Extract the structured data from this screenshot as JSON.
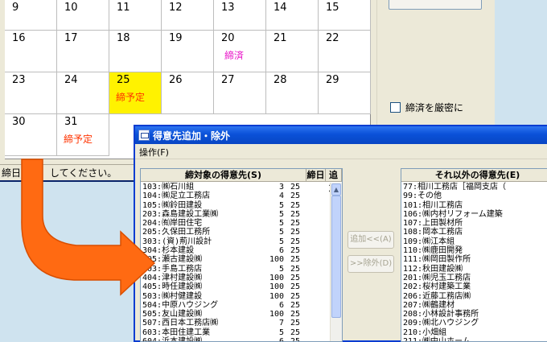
{
  "calendar": {
    "rows": [
      [
        {
          "day": "9"
        },
        {
          "day": "10"
        },
        {
          "day": "11"
        },
        {
          "day": "12"
        },
        {
          "day": "13"
        },
        {
          "day": "14"
        },
        {
          "day": "15"
        }
      ],
      [
        {
          "day": "16"
        },
        {
          "day": "17"
        },
        {
          "day": "18"
        },
        {
          "day": "19"
        },
        {
          "day": "20",
          "status": "締済",
          "status_type": "done"
        },
        {
          "day": "21"
        },
        {
          "day": "22"
        }
      ],
      [
        {
          "day": "23"
        },
        {
          "day": "24"
        },
        {
          "day": "25",
          "status": "締予定",
          "status_type": "due",
          "highlight": true
        },
        {
          "day": "26"
        },
        {
          "day": "27"
        },
        {
          "day": "28"
        },
        {
          "day": "29"
        }
      ],
      [
        {
          "day": "30"
        },
        {
          "day": "31",
          "status": "締予定",
          "status_type": "due"
        }
      ]
    ]
  },
  "side": {
    "checkbox_label": "締済を厳密に"
  },
  "statusbar": {
    "text_left": "締日",
    "text_right": "してください。"
  },
  "dialog": {
    "title": "得意先追加・除外",
    "menu": "操作(F)",
    "left": {
      "header_name": "締対象の得意先(S)",
      "header_day": "締日",
      "header_mode": "追加",
      "rows": [
        {
          "name": "103:㈱石川組",
          "day": "3",
          "mode": "25"
        },
        {
          "name": "104:㈱足立工務店",
          "day": "4",
          "mode": "25"
        },
        {
          "name": "105:㈱鈴田建設",
          "day": "5",
          "mode": "25"
        },
        {
          "name": "203:森島建設工業㈱",
          "day": "5",
          "mode": "25"
        },
        {
          "name": "204:㈲岸田住宅",
          "day": "5",
          "mode": "25"
        },
        {
          "name": "205:久保田工務所",
          "day": "5",
          "mode": "25"
        },
        {
          "name": "303:(資)荊川設計",
          "day": "5",
          "mode": "25"
        },
        {
          "name": "304:杉本建設",
          "day": "6",
          "mode": "25"
        },
        {
          "name": "305:瀬古建設㈱",
          "day": "100",
          "mode": "25"
        },
        {
          "name": "403:手島工務店",
          "day": "5",
          "mode": "25"
        },
        {
          "name": "404:津村建設㈱",
          "day": "100",
          "mode": "25"
        },
        {
          "name": "405:時任建設㈱",
          "day": "100",
          "mode": "25"
        },
        {
          "name": "503:㈱村健建設",
          "day": "100",
          "mode": "25"
        },
        {
          "name": "504:中原ハウジング",
          "day": "6",
          "mode": "25"
        },
        {
          "name": "505:友山建設㈱",
          "day": "100",
          "mode": "25"
        },
        {
          "name": "507:西日本工務店㈱",
          "day": "7",
          "mode": "25"
        },
        {
          "name": "603:本田住建工業",
          "day": "5",
          "mode": "25"
        },
        {
          "name": "604:浜本建設㈱",
          "day": "6",
          "mode": "25"
        }
      ]
    },
    "buttons": {
      "add": "追加<<(A)",
      "remove": ">>除外(D)"
    },
    "right": {
      "header_name": "それ以外の得意先(E)",
      "rows": [
        "77:相川工務店［福岡支店（",
        "99:その他",
        "101:相川工務店",
        "106:㈱内村リフォーム建築",
        "107:上田製材所",
        "108:岡本工務店",
        "109:㈱江本組",
        "110:㈱鹿田開発",
        "111:㈱岡田製作所",
        "112:秋田建設㈱",
        "201:㈱児玉工務店",
        "202:桜村建築工業",
        "206:近藤工務店㈱",
        "207:㈱鶴建材",
        "208:小林設計事務所",
        "209:㈱北ハウジング",
        "210:小畑組",
        "211:㈱中山ホーム"
      ]
    }
  }
}
